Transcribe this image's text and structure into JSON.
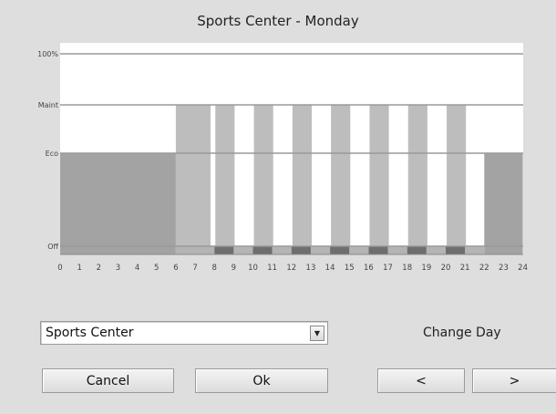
{
  "window": {
    "title": "Sports Center - Monday"
  },
  "schedule": {
    "y_levels": [
      "100%",
      "Maint",
      "Eco",
      "Off"
    ],
    "x_ticks": [
      "0",
      "1",
      "2",
      "3",
      "4",
      "5",
      "6",
      "7",
      "8",
      "9",
      "10",
      "11",
      "12",
      "13",
      "14",
      "15",
      "16",
      "17",
      "18",
      "19",
      "20",
      "21",
      "22",
      "23",
      "24"
    ]
  },
  "controls": {
    "zone_select": {
      "value": "Sports Center"
    },
    "change_day_label": "Change Day",
    "cancel_label": "Cancel",
    "ok_label": "Ok",
    "prev_label": "<",
    "next_label": ">"
  },
  "colors": {
    "eco_block": "#a3a3a3",
    "maint_bar": "#bdbdbd",
    "off_strip_dark": "#6e6e6e",
    "off_strip_light": "#b4b4b4",
    "plot_bg": "#ffffff"
  }
}
